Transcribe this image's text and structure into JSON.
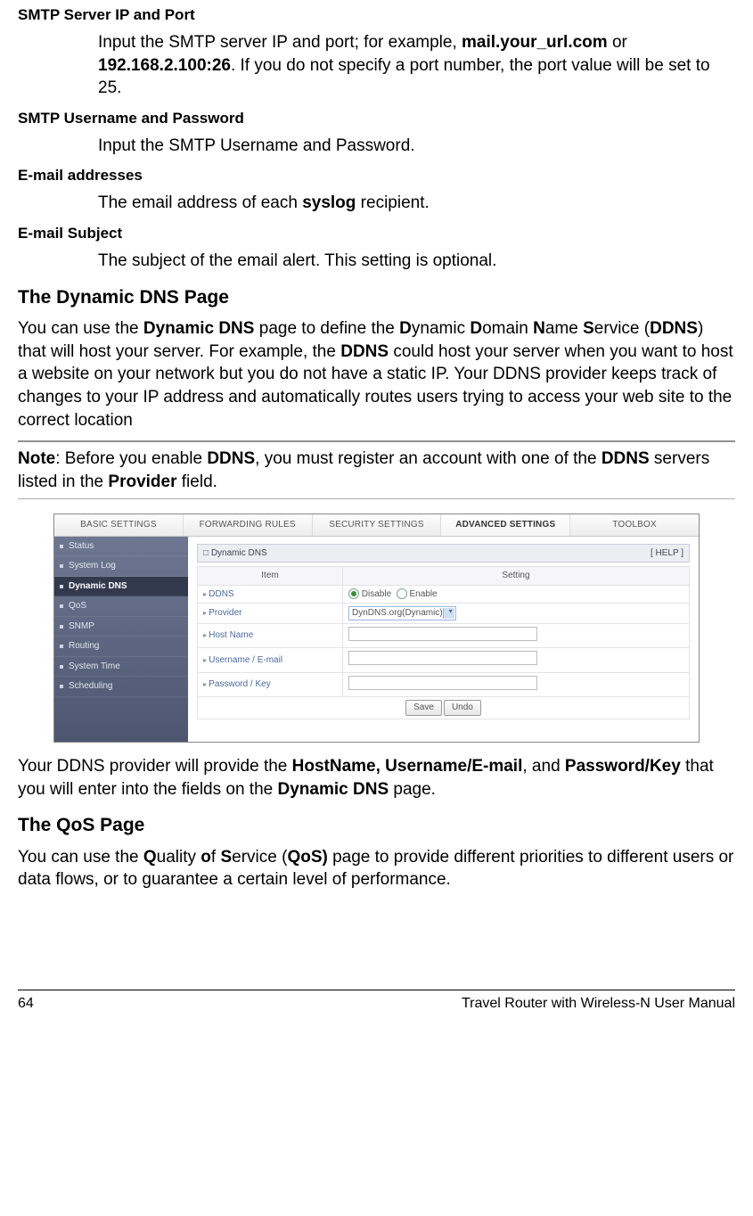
{
  "defs": {
    "smtp_ip": {
      "title": "SMTP Server IP and Port",
      "body_pre": "Input the SMTP server IP and port; for example, ",
      "ex1": "mail.your_url.com",
      "body_mid": " or ",
      "ex2": "192.168.2.100:26",
      "body_post": ". If you do not specify a port number, the port value will be set to 25."
    },
    "smtp_user": {
      "title": "SMTP Username and Password",
      "body": "Input the SMTP Username and Password."
    },
    "email_addr": {
      "title": "E-mail addresses",
      "body_pre": "The email address of each ",
      "b": "syslog",
      "body_post": " recipient."
    },
    "email_subj": {
      "title": "E-mail Subject",
      "body": "The subject of the email alert. This setting is optional."
    }
  },
  "ddns": {
    "heading": "The Dynamic DNS Page",
    "p1_a": "You can use the ",
    "p1_b": "Dynamic DNS",
    "p1_c": " page to define the ",
    "p1_d": "D",
    "p1_e": "ynamic ",
    "p1_f": "D",
    "p1_g": "omain ",
    "p1_h": "N",
    "p1_i": "ame ",
    "p1_j": "S",
    "p1_k": "ervice (",
    "p1_l": "DDNS",
    "p1_m": ") that will host your server. For example, the ",
    "p1_n": "DDNS",
    "p1_o": " could host your server when you want to host a website on your network but you do not have a static IP. Your DDNS provider keeps track of changes to your IP address and automatically routes users trying to access your web site to the correct location"
  },
  "note": {
    "a": "Note",
    "b": ": Before you enable ",
    "c": "DDNS",
    "d": ", you must register an account with one of the ",
    "e": "DDNS",
    "f": " servers listed in the ",
    "g": "Provider",
    "h": " field."
  },
  "shot": {
    "tabs": [
      "BASIC SETTINGS",
      "FORWARDING RULES",
      "SECURITY SETTINGS",
      "ADVANCED SETTINGS",
      "TOOLBOX"
    ],
    "active_tab": 3,
    "side": [
      "Status",
      "System Log",
      "Dynamic DNS",
      "QoS",
      "SNMP",
      "Routing",
      "System Time",
      "Scheduling"
    ],
    "side_active": 2,
    "panel_title": "Dynamic DNS",
    "help": "[ HELP ]",
    "th_item": "Item",
    "th_setting": "Setting",
    "rows": {
      "ddns": "DDNS",
      "provider": "Provider",
      "host": "Host Name",
      "user": "Username / E-mail",
      "pass": "Password / Key"
    },
    "disable": "Disable",
    "enable": "Enable",
    "provider_sel": "DynDNS.org(Dynamic)",
    "save": "Save",
    "undo": "Undo"
  },
  "after": {
    "a": "Your DDNS provider will provide the ",
    "b": "HostName, Username/E-mail",
    "c": ", and ",
    "d": "Password/Key",
    "e": " that you will enter into the fields on the ",
    "f": "Dynamic DNS",
    "g": " page."
  },
  "qos": {
    "heading": "The QoS Page",
    "a": "You can use the ",
    "b": "Q",
    "c": "uality ",
    "d": "o",
    "e": "f ",
    "f": "S",
    "g": "ervice (",
    "h": "QoS)",
    "i": " page to provide different priorities to different users or data flows, or to guarantee a certain level of performance."
  },
  "footer": {
    "page": "64",
    "title": "Travel Router with Wireless-N User Manual"
  }
}
